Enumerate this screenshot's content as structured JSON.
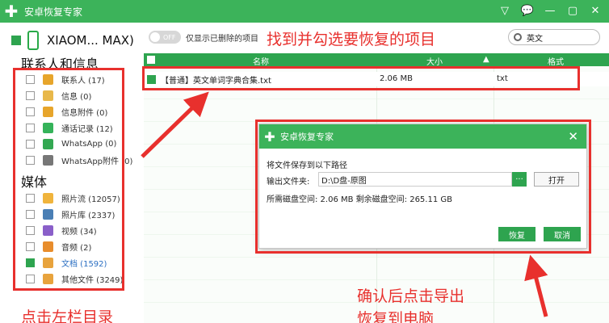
{
  "window": {
    "title": "安卓恢复专家",
    "logo_glyph": "✚",
    "controls": [
      "▽",
      "💬",
      "—",
      "▢",
      "✕"
    ]
  },
  "device": {
    "name": "XIAOM... MAX)"
  },
  "sidebar": {
    "groups": [
      {
        "title": "联系人和信息",
        "items": [
          {
            "label": "联系人 (17)",
            "icon": "contacts-icon",
            "color": "#e7a52b",
            "checked": false
          },
          {
            "label": "信息 (0)",
            "icon": "message-icon",
            "color": "#e8b84a",
            "checked": false
          },
          {
            "label": "信息附件 (0)",
            "icon": "attachment-icon",
            "color": "#e7a52b",
            "checked": false
          },
          {
            "label": "通话记录 (12)",
            "icon": "call-log-icon",
            "color": "#35b35a",
            "checked": false
          },
          {
            "label": "WhatsApp (0)",
            "icon": "whatsapp-icon",
            "color": "#33a852",
            "checked": false
          },
          {
            "label": "WhatsApp附件 (0)",
            "icon": "whatsapp-attachment-icon",
            "color": "#777777",
            "checked": false
          }
        ]
      },
      {
        "title": "媒体",
        "items": [
          {
            "label": "照片流 (12057)",
            "icon": "photo-stream-icon",
            "color": "#f0b43c",
            "checked": false
          },
          {
            "label": "照片库 (2337)",
            "icon": "photo-library-icon",
            "color": "#4a7fb5",
            "checked": false
          },
          {
            "label": "视频 (34)",
            "icon": "video-icon",
            "color": "#8a5fc9",
            "checked": false
          },
          {
            "label": "音频 (2)",
            "icon": "audio-icon",
            "color": "#e88d2c",
            "checked": false
          },
          {
            "label": "文档 (1592)",
            "icon": "document-icon",
            "color": "#e8a33d",
            "checked": true
          },
          {
            "label": "其他文件 (3249)",
            "icon": "other-files-icon",
            "color": "#e8a33d",
            "checked": false
          }
        ]
      }
    ]
  },
  "toolbar": {
    "toggle_text": "OFF",
    "toggle_label": "仅显示已删除的项目",
    "search_value": "英文"
  },
  "table": {
    "headers": [
      "名称",
      "大小",
      "格式"
    ],
    "rows": [
      {
        "name": "【普通】英文单词字典合集.txt",
        "size": "2.06 MB",
        "format": "txt",
        "checked": true
      }
    ]
  },
  "dialog": {
    "title": "安卓恢复专家",
    "heading": "将文件保存到以下路径",
    "output_label": "输出文件夹:",
    "output_path": "D:\\D盘-原图",
    "browse_label": "···",
    "open_label": "打开",
    "space_text": "所需磁盘空间:  2.06 MB  剩余磁盘空间:  265.11 GB",
    "recover_label": "恢复",
    "cancel_label": "取消"
  },
  "annotations": {
    "top_text": "找到并勾选要恢复的项目",
    "bottom_text_1": "确认后点击导出",
    "bottom_text_2": "恢复到电脑",
    "left_text": "点击左栏目录",
    "color": "#e8302d"
  }
}
